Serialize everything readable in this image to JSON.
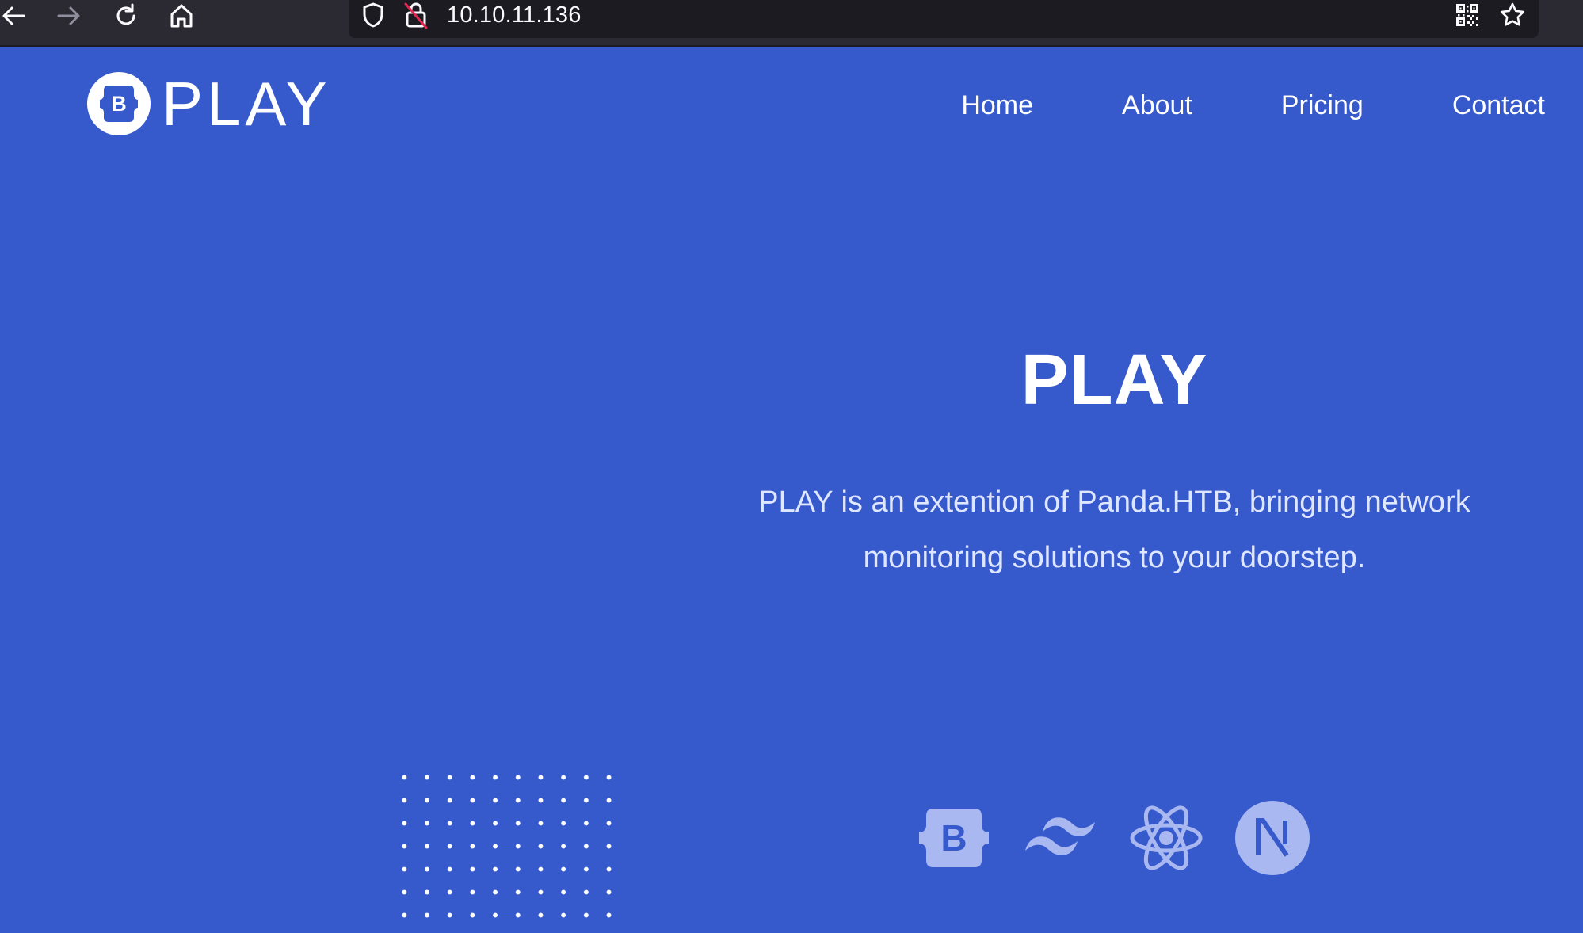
{
  "browser": {
    "url": "10.10.11.136",
    "icons": [
      "back-arrow-icon",
      "forward-arrow-icon",
      "reload-icon",
      "home-icon",
      "shield-icon",
      "insecure-lock-icon",
      "qr-code-icon",
      "bookmark-star-icon"
    ]
  },
  "site": {
    "logo_text": "PLAY",
    "nav": [
      {
        "label": "Home"
      },
      {
        "label": "About"
      },
      {
        "label": "Pricing"
      },
      {
        "label": "Contact"
      }
    ]
  },
  "hero": {
    "title": "PLAY",
    "description": "PLAY is an extention of Panda.HTB, bringing network monitoring solutions to your doorstep."
  },
  "tech_icons": [
    "bootstrap-icon",
    "tailwind-icon",
    "react-icon",
    "nextjs-icon"
  ],
  "colors": {
    "background": "#3659cc",
    "chrome": "#2b2a33",
    "urlbar": "#1c1b22",
    "icon_tint": "#a9b8f0"
  }
}
